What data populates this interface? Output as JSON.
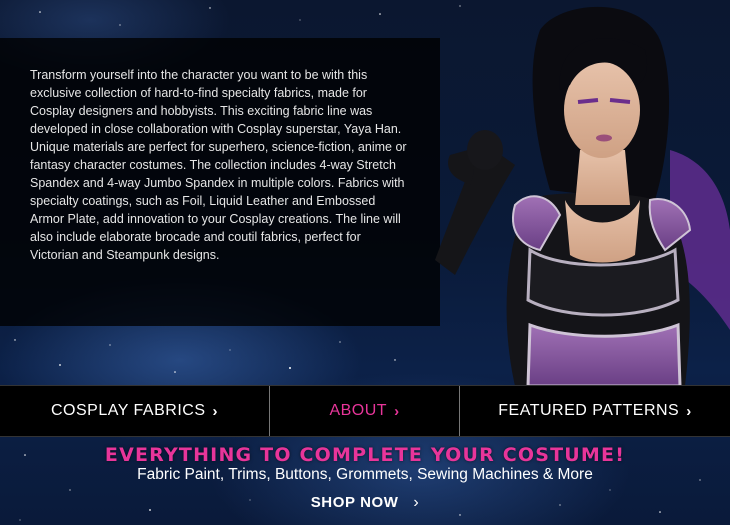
{
  "intro": {
    "text": "Transform yourself into the character you want to be with this exclusive collection of hard-to-find specialty fabrics, made for Cosplay designers and hobbyists. This exciting fabric line was developed in close collaboration with Cosplay superstar, Yaya Han. Unique materials are perfect for superhero, science-fiction, anime or fantasy character costumes. The collection includes 4-way Stretch Spandex and 4-way Jumbo Spandex in multiple colors. Fabrics with specialty coatings, such as Foil, Liquid Leather and Embossed Armor Plate, add innovation to your Cosplay creations. The line will also include elaborate brocade and coutil fabrics, perfect for Victorian and Steampunk designs."
  },
  "nav": {
    "items": [
      {
        "label": "COSPLAY FABRICS",
        "chevron": "›"
      },
      {
        "label": "ABOUT",
        "chevron": "›"
      },
      {
        "label": "FEATURED PATTERNS",
        "chevron": "›"
      }
    ]
  },
  "promo": {
    "title": "EVERYTHING TO COMPLETE YOUR COSTUME!",
    "subtitle": "Fabric Paint, Trims, Buttons, Grommets, Sewing Machines & More",
    "cta": "SHOP NOW",
    "cta_chevron": "›"
  },
  "colors": {
    "accent_pink": "#e8359a",
    "nav_bg": "#000000",
    "space_bg": "#0a1a38"
  }
}
